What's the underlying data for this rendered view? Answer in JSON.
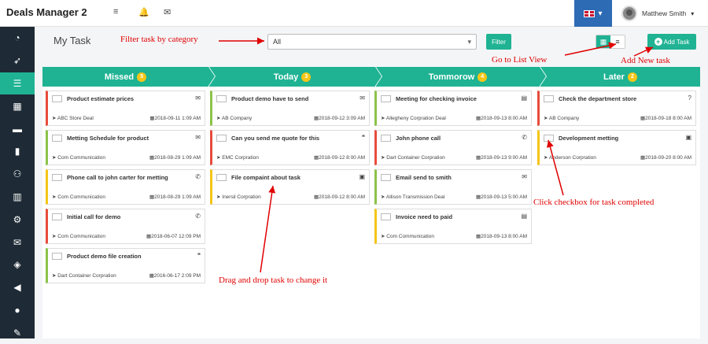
{
  "app": {
    "title": "Deals Manager 2"
  },
  "topbar": {
    "icons": [
      {
        "name": "menu-icon",
        "glyph": "≡"
      },
      {
        "name": "bell-icon",
        "glyph": "🔔"
      },
      {
        "name": "envelope-icon",
        "glyph": "✉"
      }
    ],
    "language_caret": "▾",
    "user": {
      "name": "Matthew Smith",
      "caret": "▾"
    }
  },
  "sidebar": {
    "items": [
      {
        "name": "dashboard-icon",
        "glyph": "◔"
      },
      {
        "name": "rocket-icon",
        "glyph": "➶"
      },
      {
        "name": "tasks-icon",
        "glyph": "☰",
        "active": true
      },
      {
        "name": "calendar-icon",
        "glyph": "▦"
      },
      {
        "name": "cart-icon",
        "glyph": "▬"
      },
      {
        "name": "building-icon",
        "glyph": "▮"
      },
      {
        "name": "users-icon",
        "glyph": "⚇"
      },
      {
        "name": "chart-icon",
        "glyph": "▥"
      },
      {
        "name": "gear-icon",
        "glyph": "⚙"
      },
      {
        "name": "mail-icon",
        "glyph": "✉"
      },
      {
        "name": "tag-icon",
        "glyph": "◈"
      },
      {
        "name": "bullhorn-icon",
        "glyph": "◀"
      },
      {
        "name": "user-icon",
        "glyph": "●"
      },
      {
        "name": "wrench-icon",
        "glyph": "✎"
      }
    ]
  },
  "page": {
    "title": "My Task"
  },
  "filter": {
    "selected": "All",
    "caret": "▾",
    "button_label": "Filter"
  },
  "view_toggle": {
    "grid_glyph": "▦",
    "list_glyph": "≡"
  },
  "add_task": {
    "label": "Add Task",
    "plus": "+"
  },
  "columns": [
    {
      "label": "Missed",
      "count": "5"
    },
    {
      "label": "Today",
      "count": "3"
    },
    {
      "label": "Tommorow",
      "count": "4"
    },
    {
      "label": "Later",
      "count": "2"
    }
  ],
  "cards": [
    [
      {
        "title": "Product estimate prices",
        "icon": "✉",
        "icon_name": "envelope-icon",
        "company": "ABC Store Deal",
        "date": "2018-09-11 1:09 AM",
        "color": "#e74c3c"
      },
      {
        "title": "Metting Schedule for product",
        "icon": "✉",
        "icon_name": "envelope-icon",
        "company": "Com Communication",
        "date": "2018-08-29 1:09 AM",
        "color": "#8bc34a"
      },
      {
        "title": "Phone call to john carter for metting",
        "icon": "✆",
        "icon_name": "phone-icon",
        "company": "Com Communication",
        "date": "2018-08-29 1:09 AM",
        "color": "#f5c518"
      },
      {
        "title": "Initial call for demo",
        "icon": "✆",
        "icon_name": "phone-icon",
        "company": "Com Communication",
        "date": "2018-06-07 12:09 PM",
        "color": "#e74c3c"
      },
      {
        "title": "Product demo file creation",
        "icon": "❝",
        "icon_name": "quote-icon",
        "company": "Dart Container Corpration",
        "date": "2016-06-17 2:09 PM",
        "color": "#8bc34a"
      }
    ],
    [
      {
        "title": "Product demo have to send",
        "icon": "✉",
        "icon_name": "envelope-icon",
        "company": "AB Company",
        "date": "2018-09-12 3:09 AM",
        "color": "#8bc34a"
      },
      {
        "title": "Can you send me quote for this",
        "icon": "❝",
        "icon_name": "quote-icon",
        "company": "EMC Corpration",
        "date": "2018-09-12 8:00 AM",
        "color": "#e74c3c"
      },
      {
        "title": "File compaint about task",
        "icon": "▣",
        "icon_name": "briefcase-icon",
        "company": "Inersil Corpration",
        "date": "2018-09-12 8:00 AM",
        "color": "#f5c518"
      }
    ],
    [
      {
        "title": "Meeting for checking invoice",
        "icon": "▤",
        "icon_name": "invoice-icon",
        "company": "Allegheny Corpration Deal",
        "date": "2018-09-13 8:00 AM",
        "color": "#8bc34a"
      },
      {
        "title": "John phone call",
        "icon": "✆",
        "icon_name": "phone-icon",
        "company": "Dart Container Corpration",
        "date": "2018-09-13 9:00 AM",
        "color": "#e74c3c"
      },
      {
        "title": "Email send to smith",
        "icon": "✉",
        "icon_name": "envelope-icon",
        "company": "Allison Transmission Deal",
        "date": "2018-09-13 5:00 AM",
        "color": "#8bc34a"
      },
      {
        "title": "Invoice need to paid",
        "icon": "▤",
        "icon_name": "invoice-icon",
        "company": "Com Communication",
        "date": "2018-09-13 8:00 AM",
        "color": "#f5c518"
      }
    ],
    [
      {
        "title": "Check the department store",
        "icon": "?",
        "icon_name": "question-icon",
        "company": "AB Company",
        "date": "2018-09-18 8:00 AM",
        "color": "#e74c3c"
      },
      {
        "title": "Development metting",
        "icon": "▣",
        "icon_name": "briefcase-icon",
        "company": "Anderson Corpration",
        "date": "2018-09-20 8:00 AM",
        "color": "#f5c518"
      }
    ]
  ],
  "card_glyphs": {
    "location": "➤",
    "calendar": "▦"
  },
  "annotations": {
    "filter": "Filter task by category",
    "list_view": "Go to List View",
    "add_task": "Add New task",
    "checkbox": "Click checkbox for task completed",
    "drag": "Drag and drop task to change it"
  }
}
